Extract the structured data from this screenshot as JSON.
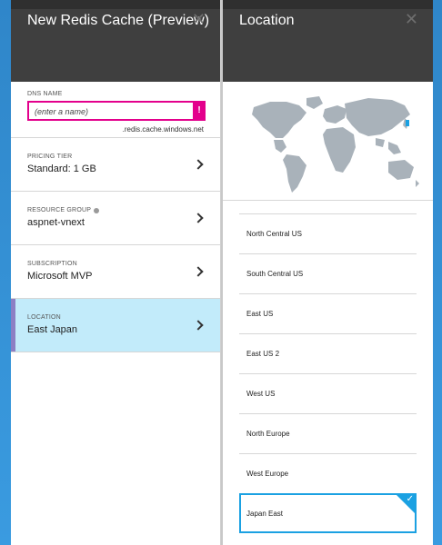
{
  "left_blade": {
    "title": "New Redis Cache (Preview)",
    "dns": {
      "label": "DNS NAME",
      "placeholder": "(enter a name)",
      "value": "",
      "error_glyph": "!",
      "suffix": ".redis.cache.windows.net"
    },
    "pricing_tier": {
      "label": "PRICING TIER",
      "value": "Standard: 1 GB"
    },
    "resource_group": {
      "label": "RESOURCE GROUP",
      "value": "aspnet-vnext",
      "info_icon": "info-icon"
    },
    "subscription": {
      "label": "SUBSCRIPTION",
      "value": "Microsoft MVP"
    },
    "location": {
      "label": "LOCATION",
      "value": "East Japan"
    }
  },
  "right_blade": {
    "title": "Location",
    "locations": [
      "North Central US",
      "South Central US",
      "East US",
      "East US 2",
      "West US",
      "North Europe",
      "West Europe",
      "Japan East"
    ],
    "selected": "Japan East"
  },
  "colors": {
    "header_bg": "#3f3f3f",
    "error_accent": "#e3008c",
    "selection_bg": "#c2ebfa",
    "selection_border": "#1ba1e2",
    "selected_marker": "#8c7fc4",
    "map_land": "#a9b2ba",
    "map_pin": "#1ba1e2"
  }
}
